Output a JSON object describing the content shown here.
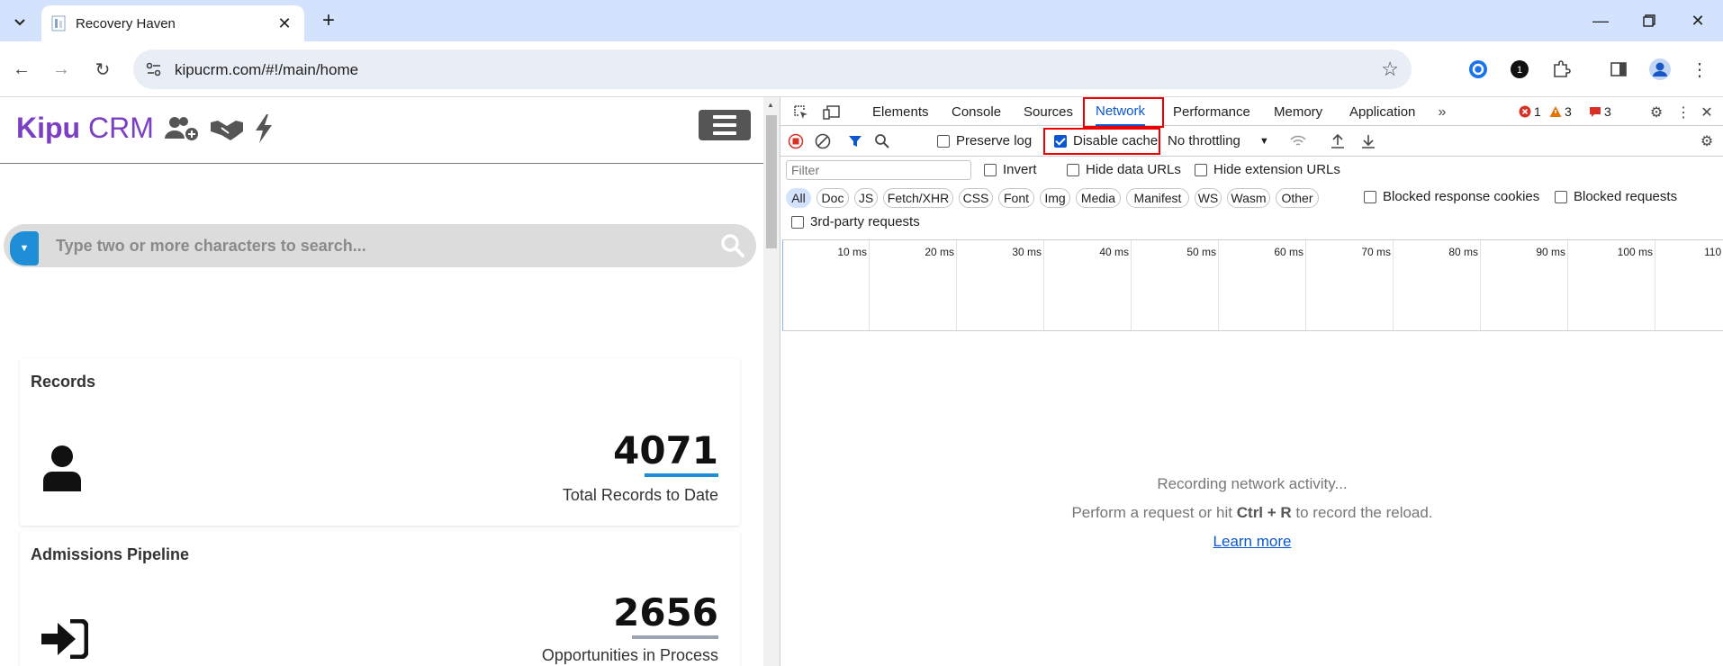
{
  "browser": {
    "tab_title": "Recovery Haven",
    "url": "kipucrm.com/#!/main/home",
    "icons": [
      "tab-search-icon",
      "close-icon",
      "plus-icon",
      "minimize-icon",
      "restore-icon",
      "close-window-icon",
      "back-icon",
      "forward-icon",
      "reload-icon",
      "site-info-icon",
      "star-icon",
      "extension-icon",
      "puzzle-icon",
      "side-panel-icon",
      "profile-icon",
      "menu-icon"
    ]
  },
  "crm": {
    "logo_brand": "Kipu",
    "logo_product": "CRM",
    "search_placeholder": "Type two or more characters to search...",
    "cards": [
      {
        "title": "Records",
        "value": "4071",
        "subtitle": "Total Records to Date",
        "bar_color": "#1e8fd6"
      },
      {
        "title": "Admissions Pipeline",
        "value": "2656",
        "subtitle": "Opportunities in Process",
        "bar_color": "#9aa5b1"
      }
    ]
  },
  "devtools": {
    "tabs": [
      "Elements",
      "Console",
      "Sources",
      "Network",
      "Performance",
      "Memory",
      "Application"
    ],
    "active_tab": "Network",
    "errors": "1",
    "warnings": "3",
    "issues": "3",
    "network": {
      "preserve_log": "Preserve log",
      "disable_cache": "Disable cache",
      "throttling": "No throttling",
      "filter_placeholder": "Filter",
      "invert": "Invert",
      "hide_data_urls": "Hide data URLs",
      "hide_extension_urls": "Hide extension URLs",
      "types": [
        "All",
        "Doc",
        "JS",
        "Fetch/XHR",
        "CSS",
        "Font",
        "Img",
        "Media",
        "Manifest",
        "WS",
        "Wasm",
        "Other"
      ],
      "blocked_response_cookies": "Blocked response cookies",
      "blocked_requests": "Blocked requests",
      "third_party": "3rd-party requests",
      "timeline_labels": [
        "10 ms",
        "20 ms",
        "30 ms",
        "40 ms",
        "50 ms",
        "60 ms",
        "70 ms",
        "80 ms",
        "90 ms",
        "100 ms",
        "110"
      ],
      "empty_line1": "Recording network activity...",
      "empty_line2_pre": "Perform a request or hit ",
      "empty_shortcut": "Ctrl + R",
      "empty_line2_post": " to record the reload.",
      "learn_more": "Learn more"
    }
  }
}
